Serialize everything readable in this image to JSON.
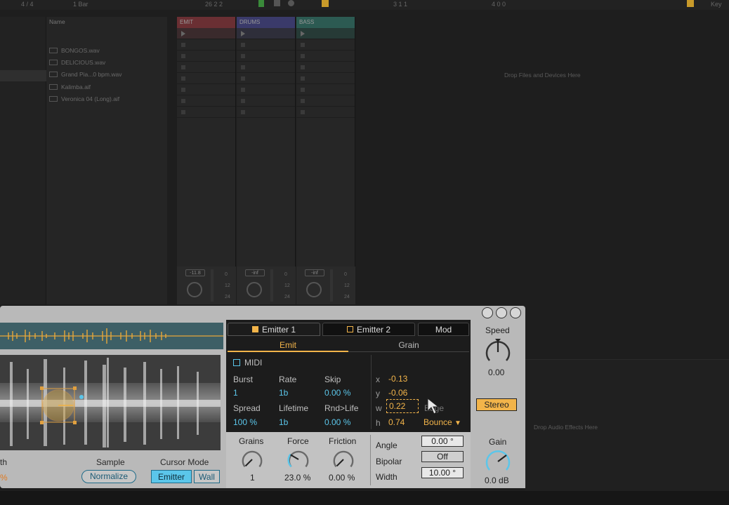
{
  "topbar": {
    "time_sig": "4 / 4",
    "quantize": "1 Bar",
    "position": "26  2  2",
    "loop": "3  1  1",
    "end": "4  0  0",
    "key_label": "Key"
  },
  "browser": {
    "column_header": "Name",
    "files": [
      "BONGOS.wav",
      "DELICIOUS.wav",
      "Grand Pia...0 bpm.wav",
      "Kalimba.aif",
      "Veronica 04 (Long).aif"
    ]
  },
  "tracks": [
    {
      "name": "EMIT",
      "color": "#c24a4a",
      "volume": "-11.8"
    },
    {
      "name": "DRUMS",
      "color": "#5a5aa8",
      "volume": "-inf"
    },
    {
      "name": "BASS",
      "color": "#3a9a86",
      "volume": "-inf"
    }
  ],
  "meter_scale": [
    "0",
    "12",
    "24"
  ],
  "session": {
    "drop_files": "Drop Files and Devices Here",
    "drop_effects": "Drop Audio Effects Here"
  },
  "device": {
    "left": {
      "cut_label": "th",
      "cut_value": "%",
      "sample_label": "Sample",
      "normalize_label": "Normalize",
      "cursor_mode_label": "Cursor Mode",
      "emitter_label": "Emitter",
      "wall_label": "Wall"
    },
    "tabs": {
      "emitter1": "Emitter 1",
      "emitter2": "Emitter 2",
      "mod": "Mod"
    },
    "subtabs": {
      "emit": "Emit",
      "grain": "Grain"
    },
    "midi_label": "MIDI",
    "params": {
      "burst_label": "Burst",
      "burst_value": "1",
      "rate_label": "Rate",
      "rate_value": "1b",
      "skip_label": "Skip",
      "skip_value": "0.00 %",
      "spread_label": "Spread",
      "spread_value": "100 %",
      "lifetime_label": "Lifetime",
      "lifetime_value": "1b",
      "rndlife_label": "Rnd>Life",
      "rndlife_value": "0.00 %"
    },
    "geometry": {
      "x_label": "x",
      "x_value": "-0.13",
      "y_label": "y",
      "y_value": "-0.06",
      "w_label": "w",
      "w_value": "0.22",
      "h_label": "h",
      "h_value": "0.74",
      "edge_label": "Edge",
      "edge_value": "Bounce"
    },
    "lower": {
      "grains_label": "Grains",
      "grains_value": "1",
      "force_label": "Force",
      "force_value": "23.0 %",
      "friction_label": "Friction",
      "friction_value": "0.00 %",
      "angle_label": "Angle",
      "angle_value": "0.00 °",
      "bipolar_label": "Bipolar",
      "bipolar_value": "Off",
      "width_label": "Width",
      "width_value": "10.00 °"
    },
    "right": {
      "speed_label": "Speed",
      "speed_value": "0.00",
      "stereo_label": "Stereo",
      "gain_label": "Gain",
      "gain_value": "0.0 dB"
    }
  },
  "colors": {
    "accent_orange": "#f2b44a",
    "accent_blue": "#5bc6ea",
    "panel_dark": "#1c1c1c",
    "device_gray": "#b9b9b9"
  }
}
